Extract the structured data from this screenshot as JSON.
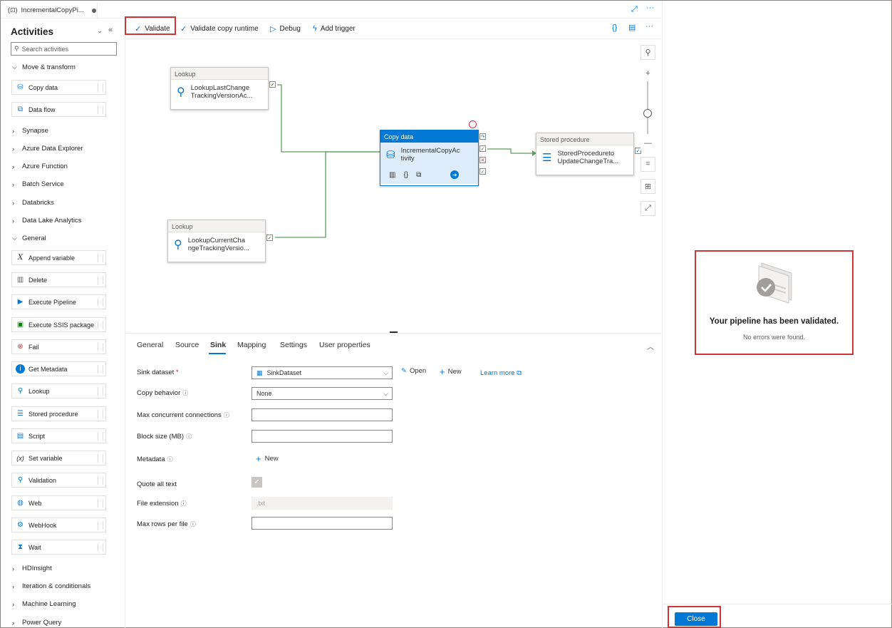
{
  "tab": {
    "title": "IncrementalCopyPi..."
  },
  "sidebar": {
    "title": "Activities",
    "search_placeholder": "Search activities",
    "categories": {
      "move_transform": "Move & transform",
      "synapse": "Synapse",
      "azure_data_explorer": "Azure Data Explorer",
      "azure_function": "Azure Function",
      "batch_service": "Batch Service",
      "databricks": "Databricks",
      "data_lake_analytics": "Data Lake Analytics",
      "general": "General",
      "hdinsight": "HDInsight",
      "iteration": "Iteration & conditionals",
      "machine_learning": "Machine Learning",
      "power_query": "Power Query"
    },
    "move_items": [
      "Copy data",
      "Data flow"
    ],
    "general_items": [
      "Append variable",
      "Delete",
      "Execute Pipeline",
      "Execute SSIS package",
      "Fail",
      "Get Metadata",
      "Lookup",
      "Stored procedure",
      "Script",
      "Set variable",
      "Validation",
      "Web",
      "WebHook",
      "Wait"
    ]
  },
  "toolbar": {
    "validate": "Validate",
    "validate_runtime": "Validate copy runtime",
    "debug": "Debug",
    "add_trigger": "Add trigger"
  },
  "canvas": {
    "node1": {
      "type": "Lookup",
      "name_l1": "LookupLastChange",
      "name_l2": "TrackingVersionAc..."
    },
    "node2": {
      "type": "Lookup",
      "name_l1": "LookupCurrentCha",
      "name_l2": "ngeTrackingVersio..."
    },
    "copy": {
      "type": "Copy data",
      "name_l1": "IncrementalCopyAc",
      "name_l2": "tivity"
    },
    "sp": {
      "type": "Stored procedure",
      "name_l1": "StoredProcedureto",
      "name_l2": "UpdateChangeTra..."
    }
  },
  "props": {
    "tabs": [
      "General",
      "Source",
      "Sink",
      "Mapping",
      "Settings",
      "User properties"
    ],
    "active_tab": "Sink",
    "sink_dataset_label": "Sink dataset",
    "sink_dataset_value": "SinkDataset",
    "open": "Open",
    "new": "New",
    "learn_more": "Learn more",
    "copy_behavior_label": "Copy behavior",
    "copy_behavior_value": "None",
    "max_conn_label": "Max concurrent connections",
    "block_size_label": "Block size (MB)",
    "metadata_label": "Metadata",
    "metadata_new": "New",
    "quote_label": "Quote all text",
    "file_ext_label": "File extension",
    "file_ext_placeholder": ".txt",
    "max_rows_label": "Max rows per file"
  },
  "validation": {
    "title": "Your pipeline has been validated.",
    "subtitle": "No errors were found.",
    "close": "Close"
  },
  "colors": {
    "accent": "#0078d4",
    "highlight": "#d13438",
    "success": "#107c10"
  }
}
